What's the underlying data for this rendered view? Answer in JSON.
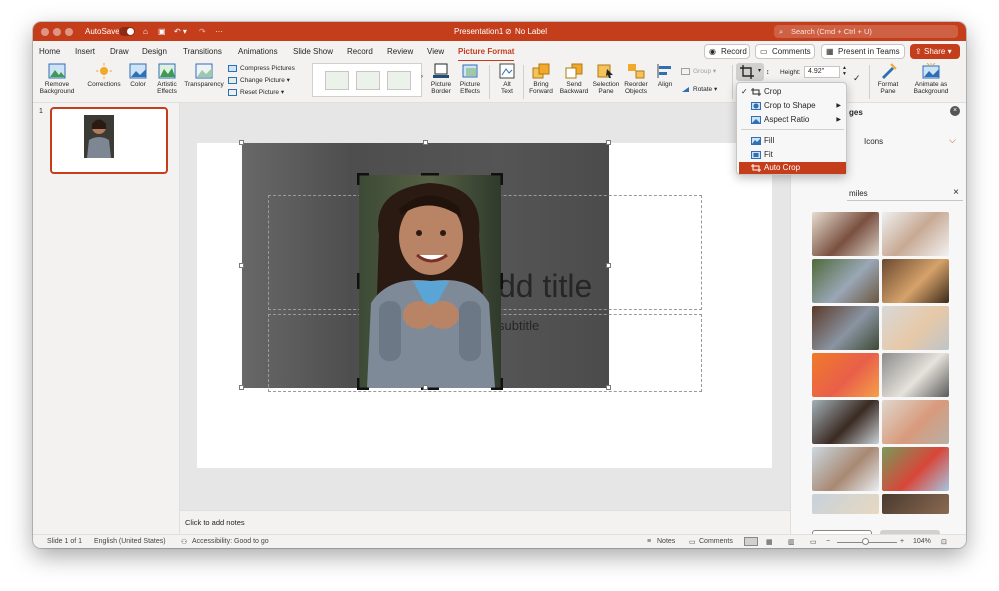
{
  "titlebar": {
    "autosave": "AutoSave",
    "document": "Presentation1",
    "label": "No Label",
    "search_placeholder": "Search (Cmd + Ctrl + U)"
  },
  "tabs": [
    "Home",
    "Insert",
    "Draw",
    "Design",
    "Transitions",
    "Animations",
    "Slide Show",
    "Record",
    "Review",
    "View",
    "Picture Format"
  ],
  "tab_actions": {
    "record": "Record",
    "comments": "Comments",
    "teams": "Present in Teams",
    "share": "Share"
  },
  "ribbon": {
    "remove_background": [
      "Remove",
      "Background"
    ],
    "corrections": "Corrections",
    "color": "Color",
    "artistic_effects": [
      "Artistic",
      "Effects"
    ],
    "transparency": "Transparency",
    "compress": "Compress Pictures",
    "change": "Change Picture",
    "reset": "Reset Picture",
    "picture_border": [
      "Picture",
      "Border"
    ],
    "picture_effects": [
      "Picture",
      "Effects"
    ],
    "alt_text": [
      "Alt",
      "Text"
    ],
    "bring_forward": [
      "Bring",
      "Forward"
    ],
    "send_backward": [
      "Send",
      "Backward"
    ],
    "selection_pane": [
      "Selection",
      "Pane"
    ],
    "reorder_objects": [
      "Reorder",
      "Objects"
    ],
    "align": "Align",
    "group": "Group",
    "rotate": "Rotate",
    "height_label": "Height:",
    "height_value": "4.92\"",
    "format_pane": [
      "Format",
      "Pane"
    ],
    "animate_background": [
      "Animate as",
      "Background"
    ]
  },
  "crop_menu": {
    "items": [
      "Crop",
      "Crop to Shape",
      "Aspect Ratio",
      "Fill",
      "Fit",
      "Auto Crop"
    ],
    "checkmark": "✓"
  },
  "slide": {
    "number": "1",
    "title_fragment": "dd title",
    "subtitle_fragment": "subtitle"
  },
  "notes_placeholder": "Click to add notes",
  "taskpane": {
    "header_fragment": "ges",
    "tab_s": "s",
    "tab_icons": "Icons",
    "search_fragment": "miles",
    "cancel": "Cancel",
    "insert": "Insert"
  },
  "status": {
    "slide": "Slide 1 of 1",
    "language": "English (United States)",
    "accessibility": "Accessibility: Good to go",
    "notes": "Notes",
    "comments": "Comments",
    "zoom": "104%"
  },
  "colors": {
    "accent": "#c43e1c",
    "highlight": "#c43e1c"
  }
}
